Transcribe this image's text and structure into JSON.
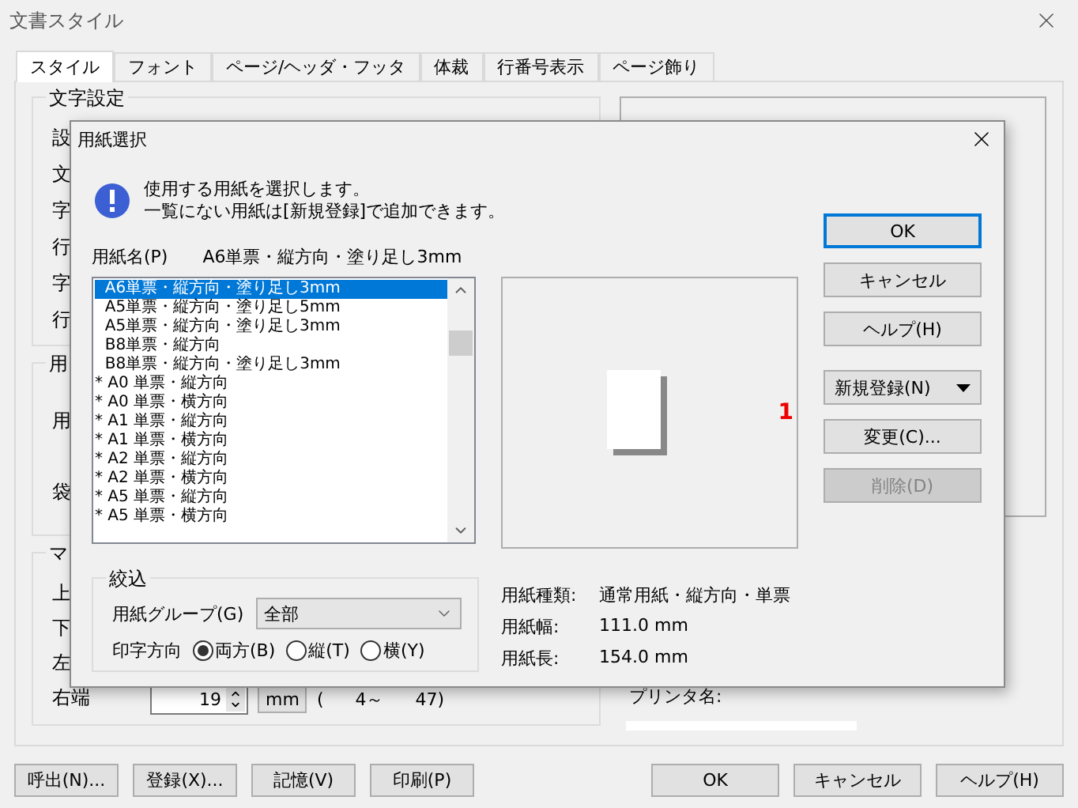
{
  "window": {
    "title": "文書スタイル"
  },
  "tabs": [
    {
      "label": "スタイル",
      "selected": true
    },
    {
      "label": "フォント",
      "selected": false
    },
    {
      "label": "ページ/ヘッダ・フッタ",
      "selected": false
    },
    {
      "label": "体裁",
      "selected": false
    },
    {
      "label": "行番号表示",
      "selected": false
    },
    {
      "label": "ページ飾り",
      "selected": false
    }
  ],
  "groups": [
    {
      "legend": "文字設定",
      "rows": [
        "設",
        "文",
        "字",
        "行",
        "字",
        "行"
      ]
    },
    {
      "legend": "用",
      "rows": [
        "用",
        "袋"
      ]
    },
    {
      "legend": "マ",
      "rows": [
        "上",
        "下",
        "左"
      ],
      "margin_row": {
        "label": "右端",
        "value": "19",
        "unit": "mm",
        "range_open": "(",
        "range_min": "4～",
        "range_max": "47)"
      }
    }
  ],
  "printer_label": "プリンタ名:",
  "bottom_buttons_left": [
    "呼出(N)...",
    "登録(X)...",
    "記憶(V)",
    "印刷(P)"
  ],
  "bottom_buttons_right": [
    "OK",
    "キャンセル",
    "ヘルプ(H)"
  ],
  "dialog": {
    "title": "用紙選択",
    "message_lines": [
      "使用する用紙を選択します。",
      "一覧にない用紙は[新規登録]で追加できます。"
    ],
    "paper_name_label": "用紙名(P)",
    "paper_name_value": "A6単票・縦方向・塗り足し3mm",
    "papers": [
      {
        "label": "  A6単票・縦方向・塗り足し3mm",
        "selected": true
      },
      {
        "label": "  A5単票・縦方向・塗り足し5mm",
        "selected": false
      },
      {
        "label": "  A5単票・縦方向・塗り足し3mm",
        "selected": false
      },
      {
        "label": "  B8単票・縦方向",
        "selected": false
      },
      {
        "label": "  B8単票・縦方向・塗り足し3mm",
        "selected": false
      },
      {
        "label": "* A0 単票・縦方向",
        "selected": false
      },
      {
        "label": "* A0 単票・横方向",
        "selected": false
      },
      {
        "label": "* A1 単票・縦方向",
        "selected": false
      },
      {
        "label": "* A1 単票・横方向",
        "selected": false
      },
      {
        "label": "* A2 単票・縦方向",
        "selected": false
      },
      {
        "label": "* A2 単票・横方向",
        "selected": false
      },
      {
        "label": "* A5 単票・縦方向",
        "selected": false
      },
      {
        "label": "* A5 単票・横方向",
        "selected": false
      }
    ],
    "preview_number": "1",
    "buttons": [
      {
        "label": "OK",
        "kind": "default",
        "disabled": false
      },
      {
        "label": "キャンセル",
        "kind": "normal",
        "disabled": false
      },
      {
        "label": "ヘルプ(H)",
        "kind": "normal",
        "disabled": false
      },
      {
        "label": "新規登録(N)",
        "kind": "dropdown",
        "disabled": false
      },
      {
        "label": "変更(C)...",
        "kind": "normal",
        "disabled": false
      },
      {
        "label": "削除(D)",
        "kind": "normal",
        "disabled": true
      }
    ],
    "filter": {
      "legend": "絞込",
      "group_label": "用紙グループ(G)",
      "group_value": "全部",
      "direction_label": "印字方向",
      "options": [
        {
          "label": "両方(B)",
          "selected": true
        },
        {
          "label": "縦(T)",
          "selected": false
        },
        {
          "label": "横(Y)",
          "selected": false
        }
      ]
    },
    "info": [
      {
        "label": "用紙種類:",
        "value": "通常用紙・縦方向・単票"
      },
      {
        "label": "用紙幅:",
        "value": "111.0 mm"
      },
      {
        "label": "用紙長:",
        "value": "154.0 mm"
      }
    ]
  }
}
